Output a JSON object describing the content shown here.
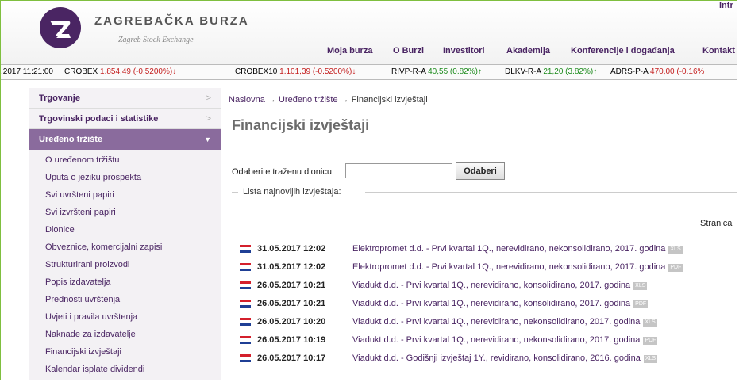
{
  "header": {
    "brand_name": "ZAGREBAČKA BURZA",
    "brand_sub": "Zagreb Stock Exchange",
    "top_link": "Intr",
    "nav": [
      "Moja burza",
      "O Burzi",
      "Investitori",
      "Akademija",
      "Konferencije i događanja",
      "Kontakt"
    ],
    "colors": {
      "brand": "#4a2563",
      "accent": "#8a6b9d"
    }
  },
  "ticker": {
    "timestamp": ".2017 11:21:00",
    "items": [
      {
        "symbol": "CROBEX",
        "value": "1.854,49 (-0.5200%)",
        "arrow": "↓",
        "trend": "down"
      },
      {
        "symbol": "CROBEX10",
        "value": "1.101,39 (-0.5200%)",
        "arrow": "↓",
        "trend": "down"
      },
      {
        "symbol": "RIVP-R-A",
        "value": "40,55 (0.82%)",
        "arrow": "↑",
        "trend": "up"
      },
      {
        "symbol": "DLKV-R-A",
        "value": "21,20 (3.82%)",
        "arrow": "↑",
        "trend": "up"
      },
      {
        "symbol": "ADRS-P-A",
        "value": "470,00 (-0.16%",
        "arrow": "",
        "trend": "down"
      }
    ]
  },
  "sidebar": {
    "top": [
      "Trgovanje",
      "Trgovinski podaci i statistike"
    ],
    "active": "Uređeno tržište",
    "items": [
      "O uređenom tržištu",
      "Uputa o jeziku prospekta",
      "Svi uvršteni papiri",
      "Svi izvršteni papiri",
      "Dionice",
      "Obveznice, komercijalni zapisi",
      "Strukturirani proizvodi",
      "Popis izdavatelja",
      "Prednosti uvrštenja",
      "Uvjeti i pravila uvrštenja",
      "Naknade za izdavatelje",
      "Financijski izvještaji",
      "Kalendar isplate dividendi"
    ]
  },
  "breadcrumb": {
    "home": "Naslovna",
    "section": "Uređeno tržište",
    "current": "Financijski izvještaji",
    "sep": "→"
  },
  "page_title": "Financijski izvještaji",
  "search": {
    "label": "Odaberite traženu dionicu",
    "value": "",
    "button": "Odaberi"
  },
  "list": {
    "title": "Lista najnovijih izvještaja:",
    "page_label": "Stranica",
    "reports": [
      {
        "date": "31.05.2017 12:02",
        "title": "Elektropromet d.d. - Prvi kvartal 1Q., nerevidirano, nekonsolidirano, 2017. godina",
        "badge": "XLS"
      },
      {
        "date": "31.05.2017 12:02",
        "title": "Elektropromet d.d. - Prvi kvartal 1Q., nerevidirano, nekonsolidirano, 2017. godina",
        "badge": "PDF"
      },
      {
        "date": "26.05.2017 10:21",
        "title": "Viadukt d.d. - Prvi kvartal 1Q., nerevidirano, konsolidirano, 2017. godina",
        "badge": "XLS"
      },
      {
        "date": "26.05.2017 10:21",
        "title": "Viadukt d.d. - Prvi kvartal 1Q., nerevidirano, konsolidirano, 2017. godina",
        "badge": "PDF"
      },
      {
        "date": "26.05.2017 10:20",
        "title": "Viadukt d.d. - Prvi kvartal 1Q., nerevidirano, nekonsolidirano, 2017. godina",
        "badge": "XLS"
      },
      {
        "date": "26.05.2017 10:19",
        "title": "Viadukt d.d. - Prvi kvartal 1Q., nerevidirano, nekonsolidirano, 2017. godina",
        "badge": "PDF"
      },
      {
        "date": "26.05.2017 10:17",
        "title": "Viadukt d.d. - Godišnji izvještaj 1Y., revidirano, konsolidirano, 2016. godina",
        "badge": "XLS"
      }
    ]
  },
  "icons": {
    "logo": "zse-logo-icon",
    "flag": "croatia-flag-icon",
    "chevron": "chevron-right-icon",
    "caret": "caret-down-icon"
  }
}
